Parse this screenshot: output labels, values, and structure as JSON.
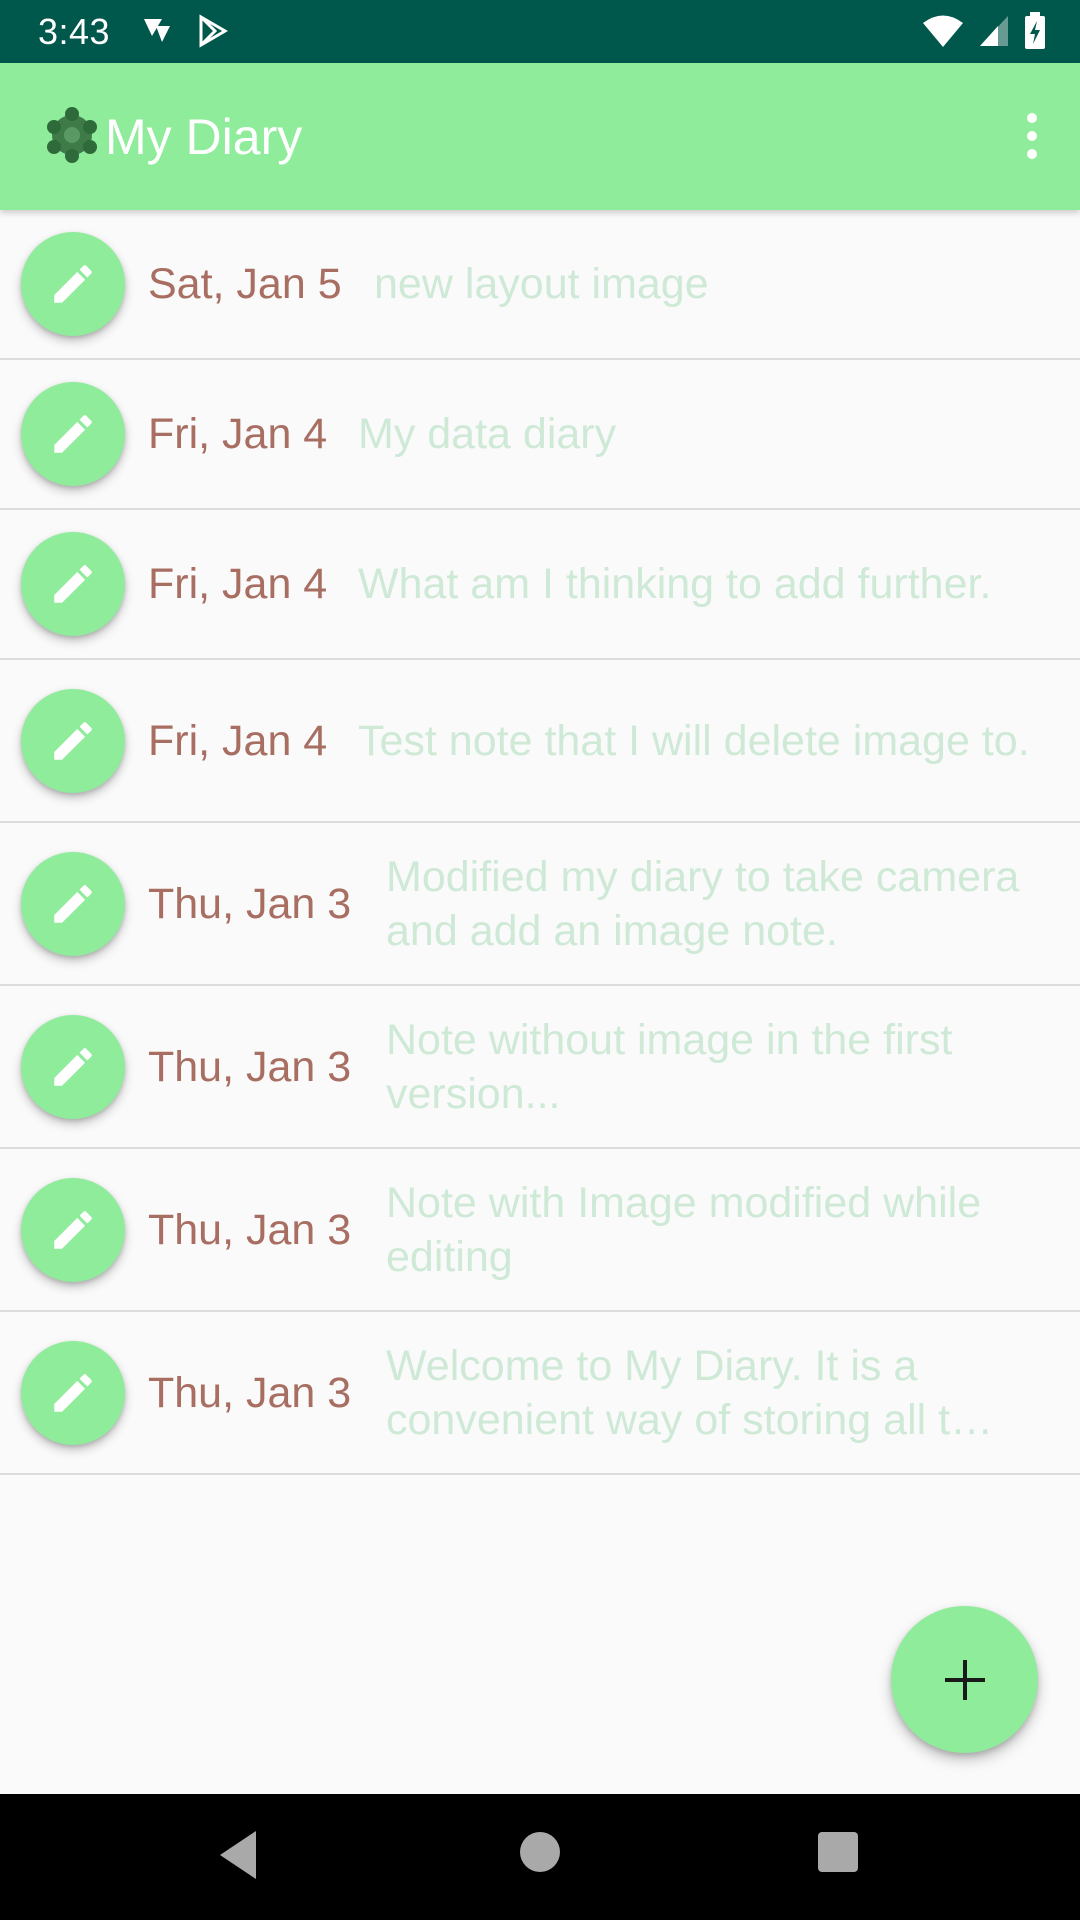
{
  "status_bar": {
    "time": "3:43",
    "icons": [
      "notification-icon",
      "play-store-icon",
      "wifi-icon",
      "signal-icon",
      "battery-icon"
    ]
  },
  "app_bar": {
    "title": "My Diary",
    "logo_icon": "diary-logo-icon",
    "overflow_icon": "more-vert-icon",
    "background": "#8eec9b"
  },
  "entries": [
    {
      "date": "Sat, Jan 5",
      "text": "new layout image"
    },
    {
      "date": "Fri, Jan 4",
      "text": "My data diary"
    },
    {
      "date": "Fri, Jan 4",
      "text": "What am I thinking to add further."
    },
    {
      "date": "Fri, Jan 4",
      "text": "Test note that I will delete image to."
    },
    {
      "date": "Thu, Jan 3",
      "text": "Modified my diary to take camera and add an image note."
    },
    {
      "date": "Thu, Jan 3",
      "text": "Note without image in the first version..."
    },
    {
      "date": "Thu, Jan 3",
      "text": "Note with Image modified while editing"
    },
    {
      "date": "Thu, Jan 3",
      "text": "Welcome to My Diary. It is a convenient way of storing all t…"
    }
  ],
  "fab": {
    "icon": "add-icon"
  },
  "nav_bar": {
    "icons": [
      "back-icon",
      "home-icon",
      "recents-icon"
    ]
  },
  "colors": {
    "accent": "#8eec9b",
    "status_bar": "#00574b",
    "date_text": "#a86e62",
    "note_text": "#cfe9d7"
  }
}
